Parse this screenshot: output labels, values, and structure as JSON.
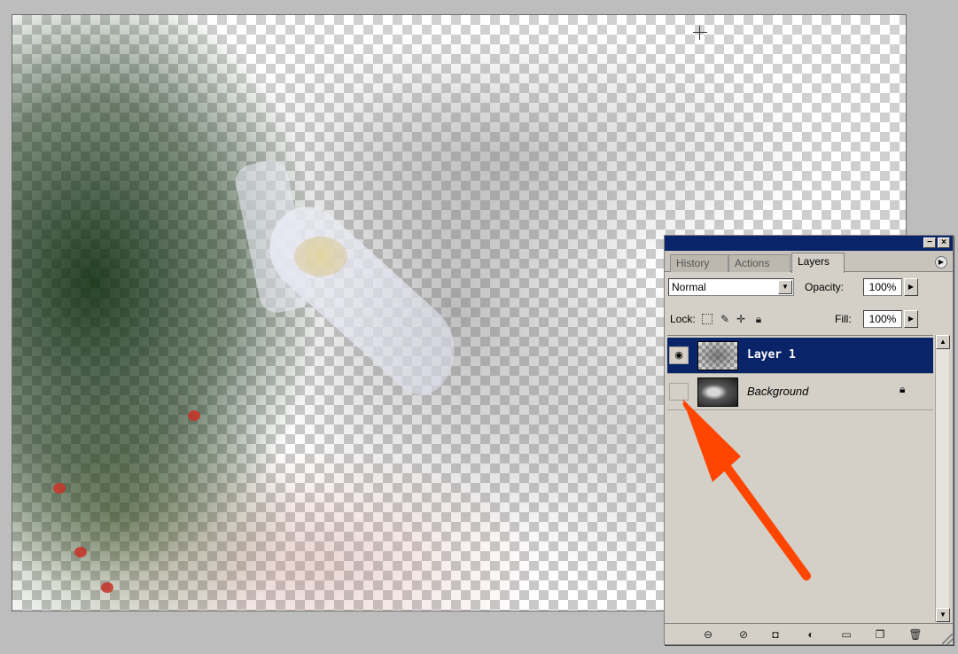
{
  "palette": {
    "tabs": [
      {
        "label": "History"
      },
      {
        "label": "Actions"
      },
      {
        "label": "Layers"
      }
    ],
    "active_tab": "Layers",
    "blend_mode": "Normal",
    "opacity_label": "Opacity:",
    "opacity_value": "100%",
    "lock_label": "Lock:",
    "fill_label": "Fill:",
    "fill_value": "100%",
    "layers": [
      {
        "name": "Layer 1",
        "visible": true,
        "selected": true
      },
      {
        "name": "Background",
        "visible": false,
        "selected": false,
        "locked": true
      }
    ],
    "icons": {
      "minimize": "minimize-icon",
      "close": "close-icon",
      "palette_menu": "palette-menu-icon",
      "eye": "eye-icon",
      "lock": "lock-icon",
      "link": "link-icon",
      "layer_style": "layer-style-icon",
      "mask": "mask-icon",
      "adjustment": "adjustment-layer-icon",
      "group": "folder-icon",
      "new_layer": "new-layer-icon",
      "delete": "trash-icon"
    }
  },
  "colors": {
    "title_bar": "#0a246a",
    "selection": "#0a246a",
    "annotation_arrow": "#ff4500"
  }
}
